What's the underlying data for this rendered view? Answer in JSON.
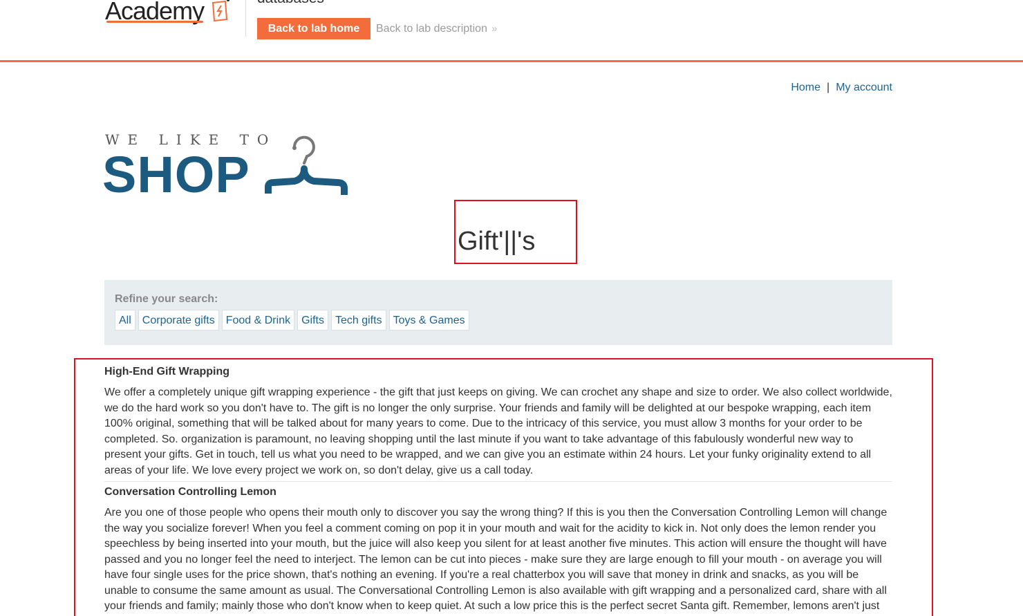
{
  "academy": {
    "logo_text": "Academy",
    "lab_title_fragment": "databases",
    "back_home_label": "Back to lab home",
    "back_description_label": "Back to lab description",
    "accent_color": "#f26c3c"
  },
  "nav": {
    "home_label": "Home",
    "separator": "|",
    "account_label": "My account"
  },
  "shop_logo": {
    "tagline": "WE LIKE TO",
    "word": "SHOP",
    "icon": "hanger-icon",
    "brand_color": "#1c5a80"
  },
  "search": {
    "term": "Gift'||'s"
  },
  "refine": {
    "label": "Refine your search:",
    "filters": [
      "All",
      "Corporate gifts",
      "Food & Drink",
      "Gifts",
      "Tech gifts",
      "Toys & Games"
    ]
  },
  "products": [
    {
      "name": "High-End Gift Wrapping",
      "description": "We offer a completely unique gift wrapping experience - the gift that just keeps on giving. We can crochet any shape and size to order. We also collect worldwide, we do the hard work so you don't have to. The gift is no longer the only surprise. Your friends and family will be delighted at our bespoke wrapping, each item 100% original, something that will be talked about for many years to come. Due to the intricacy of this service, you must allow 3 months for your order to be completed. So. organization is paramount, no leaving shopping until the last minute if you want to take advantage of this fabulously wonderful new way to present your gifts. Get in touch, tell us what you need to be wrapped, and we can give you an estimate within 24 hours. Let your funky originality extend to all areas of your life. We love every project we work on, so don't delay, give us a call today."
    },
    {
      "name": "Conversation Controlling Lemon",
      "description": "Are you one of those people who opens their mouth only to discover you say the wrong thing? If this is you then the Conversation Controlling Lemon will change the way you socialize forever! When you feel a comment coming on pop it in your mouth and wait for the acidity to kick in. Not only does the lemon render you speechless by being inserted into your mouth, but the juice will also keep you silent for at least another five minutes. This action will ensure the thought will have passed and you no longer feel the need to interject. The lemon can be cut into pieces - make sure they are large enough to fill your mouth - on average you will have four single uses for the price shown, that's nothing an evening. If you're a real chatterbox you will save that money in drink and snacks, as you will be unable to consume the same amount as usual. The Conversational Controlling Lemon is also available with gift wrapping and a personalized card, share with all your friends and family; mainly those who don't know when to keep quiet. At such a low price this is the perfect secret Santa gift. Remember, lemons aren't just"
    }
  ]
}
